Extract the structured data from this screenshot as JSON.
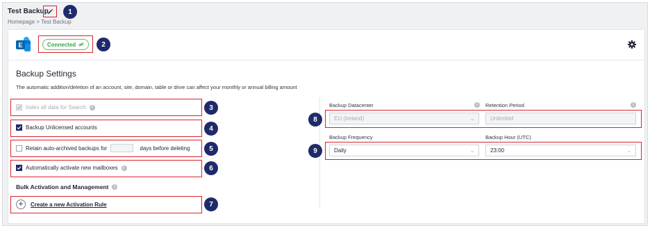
{
  "header": {
    "title": "Test Backup",
    "breadcrumb": {
      "home": "Homepage",
      "separator": " > ",
      "current": "Test Backup"
    }
  },
  "connection": {
    "status_label": "Connected",
    "status_color": "#3aa54b"
  },
  "annotations": {
    "badges": [
      "1",
      "2",
      "3",
      "4",
      "5",
      "6",
      "7",
      "8",
      "9"
    ],
    "highlight_color": "#d9232d",
    "badge_color": "#1f2a6b"
  },
  "settings": {
    "title": "Backup Settings",
    "description": "The automatic addition/deletion of an account, site, domain, table or drive can affect your monthly or annual billing amount",
    "options": {
      "index_search": {
        "label": "Index all data for Search",
        "checked": true,
        "disabled": true
      },
      "unlicensed": {
        "label": "Backup Unlicensed accounts",
        "checked": true
      },
      "retain": {
        "label_before": "Retain auto-archived backups for",
        "days_value": "",
        "label_after": "days before deleting",
        "checked": false
      },
      "auto_activate": {
        "label": "Automatically activate new mailboxes",
        "checked": true
      }
    },
    "bulk": {
      "title": "Bulk Activation and Management",
      "create_rule_label": "Create a new Activation Rule"
    }
  },
  "right": {
    "datacenter": {
      "label": "Backup Datacenter",
      "value": "EU (Ireland)"
    },
    "retention": {
      "label": "Retention Period",
      "value": "Unlimited"
    },
    "frequency": {
      "label": "Backup Frequency",
      "value": "Daily"
    },
    "hour": {
      "label": "Backup Hour (UTC)",
      "value": "23:00"
    }
  }
}
